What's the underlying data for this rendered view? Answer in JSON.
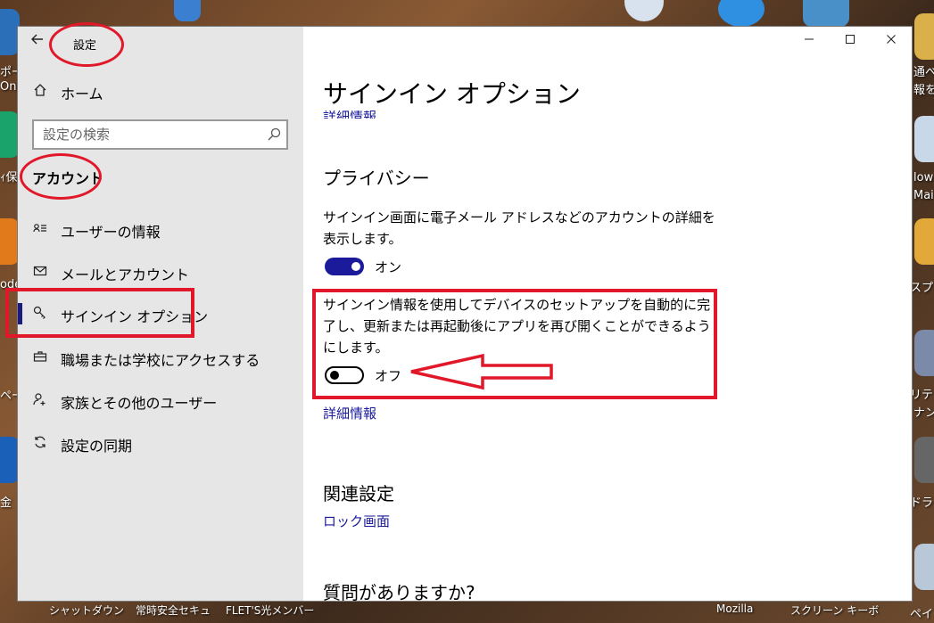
{
  "window": {
    "app_title": "設定",
    "back_icon": "back-arrow-icon",
    "caption": {
      "minimize": "minimize-icon",
      "maximize": "maximize-icon",
      "close": "close-icon"
    }
  },
  "sidebar": {
    "home_label": "ホーム",
    "search_placeholder": "設定の検索",
    "section_heading": "アカウント",
    "items": [
      {
        "label": "ユーザーの情報",
        "icon": "user-info-icon"
      },
      {
        "label": "メールとアカウント",
        "icon": "mail-icon"
      },
      {
        "label": "サインイン オプション",
        "icon": "key-icon",
        "selected": true
      },
      {
        "label": "職場または学校にアクセスする",
        "icon": "briefcase-icon"
      },
      {
        "label": "家族とその他のユーザー",
        "icon": "add-user-icon"
      },
      {
        "label": "設定の同期",
        "icon": "sync-icon"
      }
    ]
  },
  "main": {
    "page_title": "サインイン オプション",
    "cut_link": "詳細情報",
    "privacy": {
      "title": "プライバシー",
      "setting1_desc": "サインイン画面に電子メール アドレスなどのアカウントの詳細を表示します。",
      "setting1_state": "オン",
      "setting2_desc": "サインイン情報を使用してデバイスのセットアップを自動的に完了し、更新または再起動後にアプリを再び開くことができるようにします。",
      "setting2_state": "オフ",
      "more_info": "詳細情報"
    },
    "related": {
      "title": "関連設定",
      "lock_screen_link": "ロック画面"
    },
    "questions": {
      "title": "質問がありますか?"
    }
  },
  "desktop": {
    "left_labels": [
      "ポー",
      "Onit",
      "ｨ保",
      "ode",
      "ペー",
      "金"
    ],
    "right_labels": [
      "通べ",
      "報を",
      "low",
      "Mai",
      "スプロ",
      "リティ",
      "ナン",
      "ドライ",
      "ペイン"
    ],
    "taskbar_labels": [
      "シャットダウン",
      "常時安全セキュ",
      "FLET'S光メンバー",
      "Mozilla",
      "スクリーン キーボ"
    ]
  },
  "colors": {
    "accent": "#1a1a9a",
    "annotation": "#e0182a",
    "sidebar_bg": "#e6e6e6"
  }
}
